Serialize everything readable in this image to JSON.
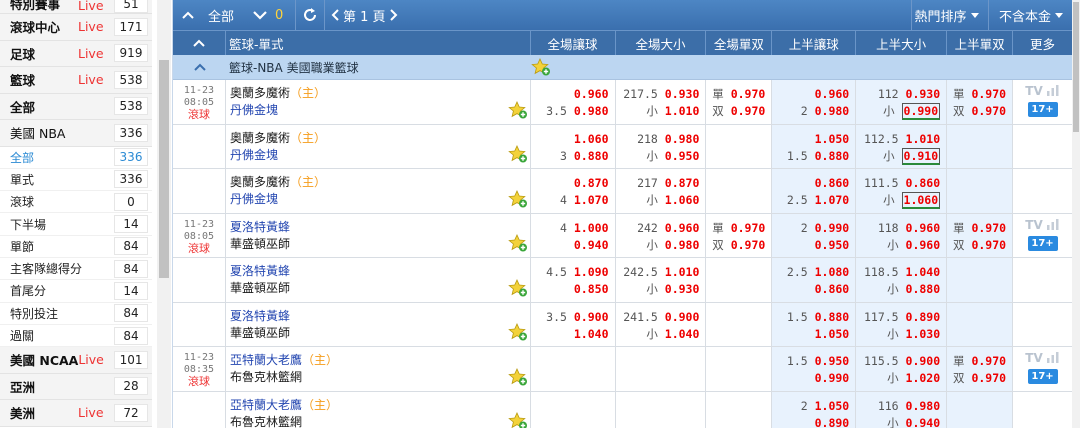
{
  "sidebar": {
    "items": [
      {
        "name": "特別賽事",
        "live": "Live",
        "count": "51",
        "bold": true,
        "type": "top"
      },
      {
        "name": "滾球中心",
        "live": "Live",
        "count": "171",
        "bold": true
      },
      {
        "name": "足球",
        "live": "Live",
        "count": "919",
        "bold": true
      },
      {
        "name": "籃球",
        "live": "Live",
        "count": "538",
        "bold": true
      },
      {
        "name": "全部",
        "live": "",
        "count": "538",
        "bold": true
      },
      {
        "name": "美國 NBA",
        "live": "",
        "count": "336",
        "bold": false
      },
      {
        "name": "全部",
        "count": "336",
        "sub": true,
        "active": true
      },
      {
        "name": "單式",
        "count": "336",
        "sub": true
      },
      {
        "name": "滾球",
        "count": "0",
        "sub": true
      },
      {
        "name": "下半場",
        "count": "14",
        "sub": true
      },
      {
        "name": "單節",
        "count": "84",
        "sub": true
      },
      {
        "name": "主客隊總得分",
        "count": "84",
        "sub": true
      },
      {
        "name": "首尾分",
        "count": "14",
        "sub": true
      },
      {
        "name": "特別投注",
        "count": "84",
        "sub": true
      },
      {
        "name": "過關",
        "count": "84",
        "sub": true
      },
      {
        "name": "美國 NCAA",
        "live": "Live",
        "count": "101",
        "bold": true
      },
      {
        "name": "亞洲",
        "live": "",
        "count": "28",
        "bold": true
      },
      {
        "name": "美洲",
        "live": "Live",
        "count": "72",
        "bold": true
      }
    ]
  },
  "toolbar": {
    "all_label": "全部",
    "selected_count": "0",
    "page_label": "第 1 頁",
    "sort_label": "熱門排序",
    "capital_label": "不含本金"
  },
  "table": {
    "sport_header": "籃球-單式",
    "columns": [
      "全場讓球",
      "全場大小",
      "全場單双",
      "上半讓球",
      "上半大小",
      "上半單双",
      "更多"
    ],
    "league": "籃球-NBA  美國職業籃球",
    "home_mark": "（主）",
    "rows": [
      {
        "date": "11-23",
        "time": "08:05",
        "live": "滾球",
        "home": "奧蘭多魔術",
        "away": "丹佛金塊",
        "hcap": [
          "",
          "3.5"
        ],
        "hcap_odds": [
          "0.960",
          "0.980"
        ],
        "ou": [
          "217.5",
          "小"
        ],
        "ou_odds": [
          "0.930",
          "1.010"
        ],
        "oe": [
          "單",
          "双"
        ],
        "oe_odds": [
          "0.970",
          "0.970"
        ],
        "h1cap": [
          "",
          "2"
        ],
        "h1cap_odds": [
          "0.960",
          "0.980"
        ],
        "h1ou": [
          "112",
          "小"
        ],
        "h1ou_odds": [
          "0.930",
          "0.990"
        ],
        "h1oe": [
          "單",
          "双"
        ],
        "h1oe_odds": [
          "0.970",
          "0.970"
        ],
        "tv": "TV",
        "more": "17+"
      },
      {
        "home": "奧蘭多魔術",
        "away": "丹佛金塊",
        "hcap": [
          "",
          "3"
        ],
        "hcap_odds": [
          "1.060",
          "0.880"
        ],
        "ou": [
          "218",
          "小"
        ],
        "ou_odds": [
          "0.980",
          "0.950"
        ],
        "h1cap": [
          "",
          "1.5"
        ],
        "h1cap_odds": [
          "1.050",
          "0.880"
        ],
        "h1ou": [
          "112.5",
          "小"
        ],
        "h1ou_odds": [
          "1.010",
          "0.910"
        ]
      },
      {
        "home": "奧蘭多魔術",
        "away": "丹佛金塊",
        "hcap": [
          "",
          "4"
        ],
        "hcap_odds": [
          "0.870",
          "1.070"
        ],
        "ou": [
          "217",
          "小"
        ],
        "ou_odds": [
          "0.870",
          "1.060"
        ],
        "h1cap": [
          "",
          "2.5"
        ],
        "h1cap_odds": [
          "0.860",
          "1.070"
        ],
        "h1ou": [
          "111.5",
          "小"
        ],
        "h1ou_odds": [
          "0.860",
          "1.060"
        ]
      },
      {
        "date": "11-23",
        "time": "08:05",
        "live": "滾球",
        "home": "夏洛特黃蜂",
        "away": "華盛頓巫師",
        "hcap": [
          "4",
          ""
        ],
        "hcap_odds": [
          "1.000",
          "0.940"
        ],
        "ou": [
          "242",
          "小"
        ],
        "ou_odds": [
          "0.960",
          "0.980"
        ],
        "oe": [
          "單",
          "双"
        ],
        "oe_odds": [
          "0.970",
          "0.970"
        ],
        "h1cap": [
          "2",
          ""
        ],
        "h1cap_odds": [
          "0.990",
          "0.950"
        ],
        "h1ou": [
          "118",
          "小"
        ],
        "h1ou_odds": [
          "0.960",
          "0.960"
        ],
        "h1oe": [
          "單",
          "双"
        ],
        "h1oe_odds": [
          "0.970",
          "0.970"
        ],
        "tv": "TV",
        "more": "17+"
      },
      {
        "home": "夏洛特黃蜂",
        "away": "華盛頓巫師",
        "hcap": [
          "4.5",
          ""
        ],
        "hcap_odds": [
          "1.090",
          "0.850"
        ],
        "ou": [
          "242.5",
          "小"
        ],
        "ou_odds": [
          "1.010",
          "0.930"
        ],
        "h1cap": [
          "2.5",
          ""
        ],
        "h1cap_odds": [
          "1.080",
          "0.860"
        ],
        "h1ou": [
          "118.5",
          "小"
        ],
        "h1ou_odds": [
          "1.040",
          "0.880"
        ]
      },
      {
        "home": "夏洛特黃蜂",
        "away": "華盛頓巫師",
        "hcap": [
          "3.5",
          ""
        ],
        "hcap_odds": [
          "0.900",
          "1.040"
        ],
        "ou": [
          "241.5",
          "小"
        ],
        "ou_odds": [
          "0.900",
          "1.040"
        ],
        "h1cap": [
          "1.5",
          ""
        ],
        "h1cap_odds": [
          "0.880",
          "1.050"
        ],
        "h1ou": [
          "117.5",
          "小"
        ],
        "h1ou_odds": [
          "0.890",
          "1.030"
        ]
      },
      {
        "date": "11-23",
        "time": "08:35",
        "live": "滾球",
        "home": "亞特蘭大老鷹",
        "away": "布魯克林籃網",
        "hcap": [
          "",
          ""
        ],
        "hcap_odds": [
          "",
          ""
        ],
        "ou": [
          "",
          ""
        ],
        "ou_odds": [
          "",
          ""
        ],
        "h1cap": [
          "1.5",
          ""
        ],
        "h1cap_odds": [
          "0.950",
          "0.990"
        ],
        "h1ou": [
          "115.5",
          "小"
        ],
        "h1ou_odds": [
          "0.900",
          "1.020"
        ],
        "h1oe": [
          "單",
          "双"
        ],
        "h1oe_odds": [
          "0.970",
          "0.970"
        ],
        "tv": "TV",
        "more": "17+"
      },
      {
        "home": "亞特蘭大老鷹",
        "away": "布魯克林籃網",
        "hcap": [
          "",
          ""
        ],
        "hcap_odds": [
          "",
          ""
        ],
        "ou": [
          "",
          ""
        ],
        "ou_odds": [
          "",
          ""
        ],
        "h1cap": [
          "2",
          ""
        ],
        "h1cap_odds": [
          "1.050",
          "0.890"
        ],
        "h1ou": [
          "116",
          "小"
        ],
        "h1ou_odds": [
          "0.980",
          "0.940"
        ]
      }
    ]
  }
}
